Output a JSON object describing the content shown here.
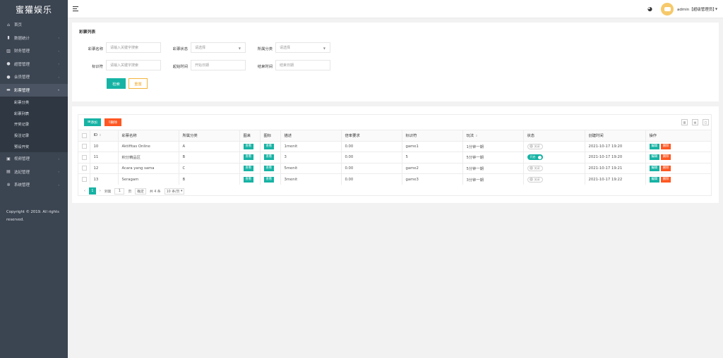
{
  "app": {
    "logo": "蜜獾娱乐"
  },
  "sidebar": {
    "items": [
      {
        "label": "首页",
        "icon": "home-icon",
        "glyph": "⌂"
      },
      {
        "label": "数据统计",
        "icon": "chart-icon",
        "glyph": "▮"
      },
      {
        "label": "财务管理",
        "icon": "bank-icon",
        "glyph": "▥"
      },
      {
        "label": "超管管理",
        "icon": "user-icon",
        "glyph": "●"
      },
      {
        "label": "会员管理",
        "icon": "users-icon",
        "glyph": "●"
      },
      {
        "label": "彩票管理",
        "icon": "ticket-icon",
        "glyph": "▬"
      }
    ],
    "sub_items": [
      "彩票分类",
      "彩票列表",
      "开奖记录",
      "投注记录",
      "预设开奖"
    ],
    "items_after": [
      {
        "label": "视频管理",
        "icon": "video-icon",
        "glyph": "▣"
      },
      {
        "label": "选妃管理",
        "icon": "list-icon",
        "glyph": "▤"
      },
      {
        "label": "系统管理",
        "icon": "gear-icon",
        "glyph": "✲"
      }
    ],
    "copyright": "Copyright © 2019. All rights reserved."
  },
  "header": {
    "user": "admin【超级管理员】"
  },
  "search": {
    "title": "彩票列表",
    "name_label": "彩票名称",
    "name_placeholder": "请输入关键字搜索",
    "status_label": "彩票状态",
    "status_placeholder": "请选择",
    "category_label": "所属分类",
    "category_placeholder": "请选择",
    "key_label": "标识符",
    "key_placeholder": "请输入关键字搜索",
    "start_label": "起始时间",
    "start_placeholder": "开始日期",
    "end_label": "结束时间",
    "end_placeholder": "结束日期",
    "search_btn": "检索",
    "reset_btn": "重置"
  },
  "table": {
    "add_btn": "添加",
    "delete_btn": "删除",
    "headers": [
      "ID",
      "彩票名称",
      "所属分类",
      "图来",
      "图标",
      "描述",
      "倍率要求",
      "标识符",
      "玩法",
      "状态",
      "创建时间",
      "操作"
    ],
    "view_label": "查看",
    "edit_label": "编辑",
    "del_label": "删除",
    "switch_off": "关闭",
    "switch_on": "开启",
    "rows": [
      {
        "id": "10",
        "name": "Aktifitas Online",
        "category": "A",
        "desc": "1menit",
        "rate": "0.00",
        "key": "game1",
        "play": "1分钟一期",
        "status": "off",
        "created": "2021-10-17 19:20"
      },
      {
        "id": "11",
        "name": "积分精品区",
        "category": "B",
        "desc": "3",
        "rate": "0.00",
        "key": "5",
        "play": "5分钟一期",
        "status": "on",
        "created": "2021-10-17 19:20"
      },
      {
        "id": "12",
        "name": "Acara yang sama",
        "category": "C",
        "desc": "5menit",
        "rate": "0.00",
        "key": "game2",
        "play": "5分钟一期",
        "status": "off",
        "created": "2021-10-17 19:21"
      },
      {
        "id": "13",
        "name": "Seragam",
        "category": "B",
        "desc": "3menit",
        "rate": "0.00",
        "key": "game3",
        "play": "3分钟一期",
        "status": "off",
        "created": "2021-10-17 19:22"
      }
    ]
  },
  "pager": {
    "prev": "‹",
    "current": "1",
    "next": "›",
    "goto_label": "到第",
    "page_value": "1",
    "page_unit": "页",
    "confirm": "确定",
    "total": "共 4 条",
    "per_page": "10 条/页"
  },
  "colors": {
    "accent": "#16b3a4",
    "danger": "#ff5722",
    "sidebar": "#3b4451"
  }
}
